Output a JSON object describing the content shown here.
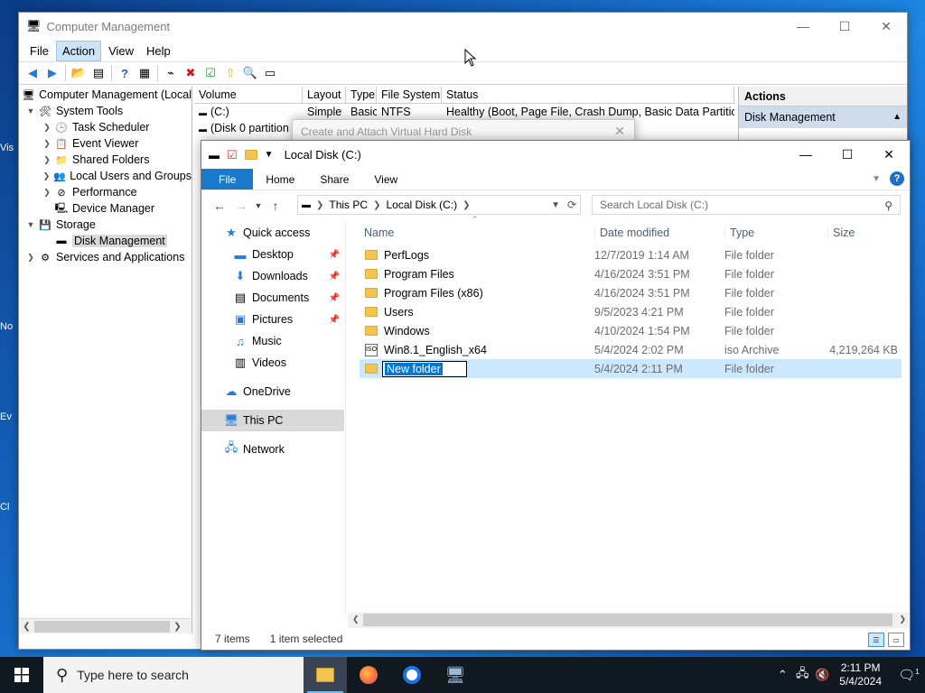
{
  "computer_management": {
    "title": "Computer Management",
    "menu": [
      "File",
      "Action",
      "View",
      "Help"
    ],
    "tree": [
      {
        "label": "Computer Management (Local",
        "level": 0
      },
      {
        "label": "System Tools",
        "level": 1
      },
      {
        "label": "Task Scheduler",
        "level": 2
      },
      {
        "label": "Event Viewer",
        "level": 2
      },
      {
        "label": "Shared Folders",
        "level": 2
      },
      {
        "label": "Local Users and Groups",
        "level": 2
      },
      {
        "label": "Performance",
        "level": 2
      },
      {
        "label": "Device Manager",
        "level": 2
      },
      {
        "label": "Storage",
        "level": 1
      },
      {
        "label": "Disk Management",
        "level": 2
      },
      {
        "label": "Services and Applications",
        "level": 1
      }
    ],
    "volume_columns": [
      "Volume",
      "Layout",
      "Type",
      "File System",
      "Status"
    ],
    "volumes": [
      {
        "volume": "(C:)",
        "layout": "Simple",
        "type": "Basic",
        "fs": "NTFS",
        "status": "Healthy (Boot, Page File, Crash Dump, Basic Data Partition)"
      },
      {
        "volume": "(Disk 0 partition",
        "layout": "",
        "type": "",
        "fs": "",
        "status": ""
      }
    ],
    "actions_header": "Actions",
    "actions_section": "Disk Management"
  },
  "vhd_dialog": {
    "title": "Create and Attach Virtual Hard Disk"
  },
  "explorer": {
    "title": "Local Disk (C:)",
    "ribbon_tabs": [
      "File",
      "Home",
      "Share",
      "View"
    ],
    "breadcrumb": [
      "This PC",
      "Local Disk (C:)"
    ],
    "search_placeholder": "Search Local Disk (C:)",
    "nav": {
      "quick_access": "Quick access",
      "pinned": [
        "Desktop",
        "Downloads",
        "Documents",
        "Pictures"
      ],
      "unpinned": [
        "Music",
        "Videos"
      ],
      "onedrive": "OneDrive",
      "this_pc": "This PC",
      "network": "Network"
    },
    "columns": [
      "Name",
      "Date modified",
      "Type",
      "Size"
    ],
    "files": [
      {
        "name": "PerfLogs",
        "date": "12/7/2019 1:14 AM",
        "type": "File folder",
        "size": ""
      },
      {
        "name": "Program Files",
        "date": "4/16/2024 3:51 PM",
        "type": "File folder",
        "size": ""
      },
      {
        "name": "Program Files (x86)",
        "date": "4/16/2024 3:51 PM",
        "type": "File folder",
        "size": ""
      },
      {
        "name": "Users",
        "date": "9/5/2023 4:21 PM",
        "type": "File folder",
        "size": ""
      },
      {
        "name": "Windows",
        "date": "4/10/2024 1:54 PM",
        "type": "File folder",
        "size": ""
      },
      {
        "name": "Win8.1_English_x64",
        "date": "5/4/2024 2:02 PM",
        "type": "iso Archive",
        "size": "4,219,264 KB"
      },
      {
        "name": "New folder",
        "date": "5/4/2024 2:11 PM",
        "type": "File folder",
        "size": ""
      }
    ],
    "status_items": "7 items",
    "status_selected": "1 item selected"
  },
  "taskbar": {
    "search_placeholder": "Type here to search",
    "time": "2:11 PM",
    "date": "5/4/2024",
    "notification_count": "1"
  },
  "desktop_fragments": [
    "Vis",
    "No",
    "Ev",
    "Cl"
  ]
}
